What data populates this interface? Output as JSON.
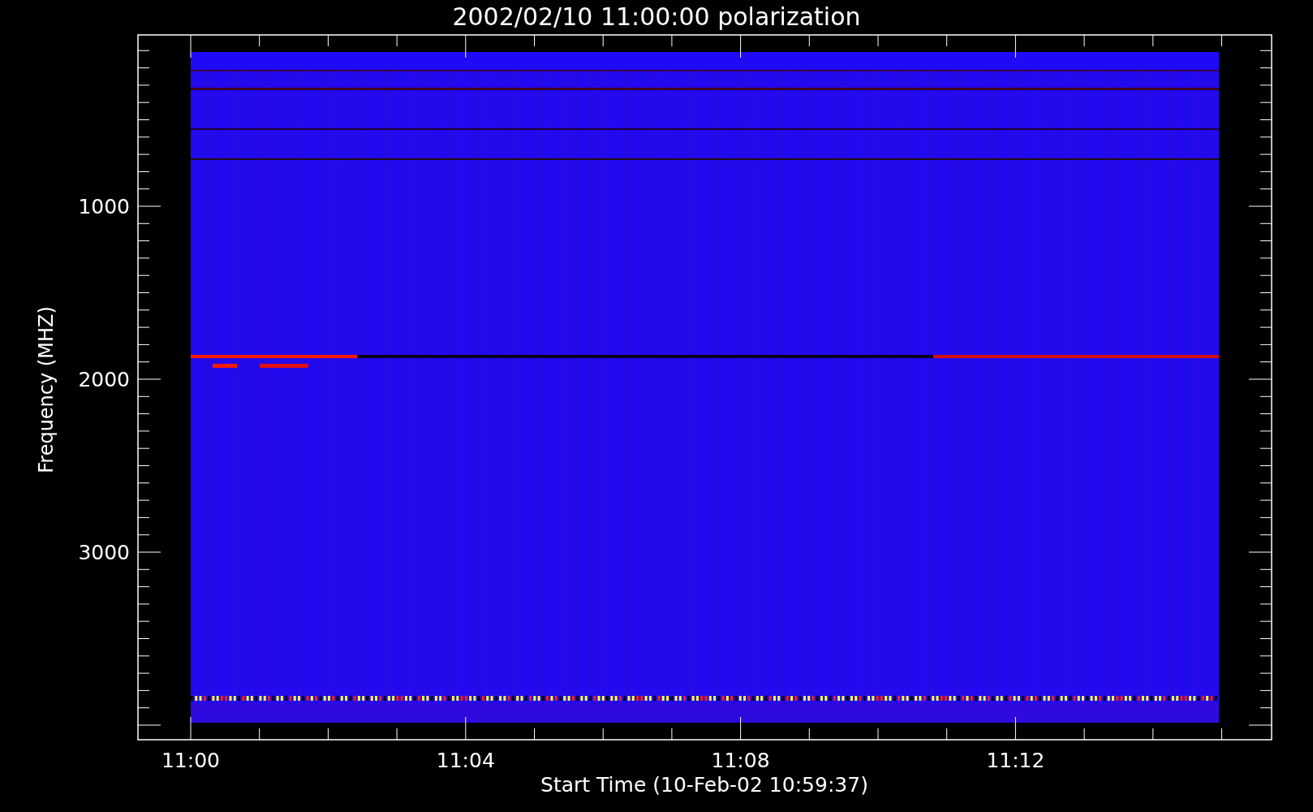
{
  "title": "2002/02/10 11:00:00 polarization",
  "y_axis": {
    "label": "Frequency (MHZ)",
    "tick_labels": [
      "1000",
      "2000",
      "3000"
    ]
  },
  "x_axis": {
    "label": "Start Time (10-Feb-02 10:59:37)",
    "tick_labels": [
      "11:00",
      "11:04",
      "11:08",
      "11:12"
    ]
  }
}
